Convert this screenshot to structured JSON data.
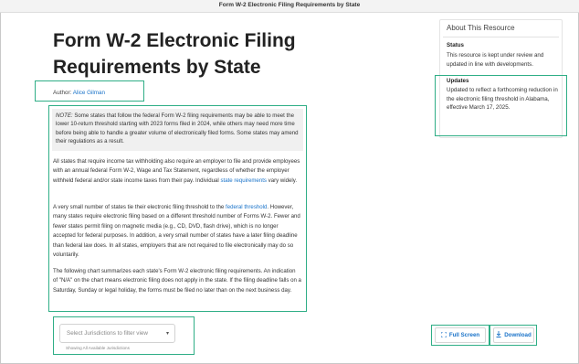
{
  "window": {
    "title": "Form W-2 Electronic Filing Requirements by State"
  },
  "article": {
    "title": "Form W-2 Electronic Filing Requirements by State",
    "author_label": "Author: ",
    "author_name": "Alice Gilman",
    "note_label": "NOTE:",
    "note_text": " Some states that follow the federal Form W-2 filing requirements may be able to meet the lower 10-return threshold starting with 2023 forms filed in 2024, while others may need more time before being able to handle a greater volume of electronically filed forms. Some states may amend their regulations as a result.",
    "p1_before": "All states that require income tax withholding also require an employer to file and provide employees with an annual federal Form W-2, Wage and Tax Statement, regardless of whether the employer withheld federal and/or state income taxes from their pay. Individual ",
    "p1_link": "state requirements",
    "p1_after": " vary widely.",
    "p2_before": "A very small number of states tie their electronic filing threshold to the ",
    "p2_link": "federal threshold",
    "p2_after": ". However, many states require electronic filing based on a different threshold number of Forms W-2. Fewer and fewer states permit filing on magnetic media (e.g., CD, DVD, flash drive), which is no longer accepted for federal purposes. In addition, a very small number of states have a later filing deadline than federal law does. In all states, employers that are not required to file electronically may do so voluntarily.",
    "p3": "The following chart summarizes each state's Form W-2 electronic filing requirements. An indication of \"N/A\" on the chart means electronic filing does not apply in the state. If the filing deadline falls on a Saturday, Sunday or legal holiday, the forms must be filed no later than on the next business day."
  },
  "sidebar": {
    "title": "About This Resource",
    "status_heading": "Status",
    "status_text": "This resource is kept under review and updated in line with developments.",
    "updates_heading": "Updates",
    "updates_text": "Updated to reflect a forthcoming reduction in the electronic filing threshold in Alabama, effective March 17, 2025."
  },
  "filter": {
    "placeholder": "Select Jurisdictions to filter view",
    "caret": "▾",
    "hint": "Showing All Available Jurisdictions"
  },
  "buttons": {
    "fullscreen_label": "Full Screen",
    "fullscreen_icon": "expand-icon",
    "download_label": "Download",
    "download_icon": "download-icon"
  },
  "colors": {
    "highlight": "#2fae86",
    "link": "#1a73c9",
    "note_bg": "#f0f0f0"
  }
}
